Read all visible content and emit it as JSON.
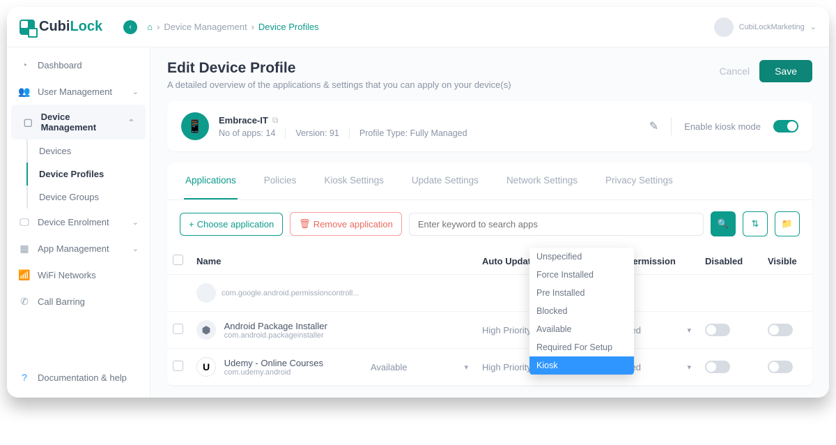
{
  "brand": {
    "name_a": "Cubi",
    "name_b": "Lock"
  },
  "breadcrumb": {
    "home": "⌂",
    "l1": "Device Management",
    "l2": "Device Profiles"
  },
  "user": {
    "name": "CubiLockMarketing"
  },
  "sidebar": {
    "items": [
      {
        "label": "Dashboard"
      },
      {
        "label": "User Management"
      },
      {
        "label": "Device Management"
      },
      {
        "label": "Device Enrolment"
      },
      {
        "label": "App Management"
      },
      {
        "label": "WiFi Networks"
      },
      {
        "label": "Call Barring"
      }
    ],
    "sub": [
      {
        "label": "Devices"
      },
      {
        "label": "Device Profiles"
      },
      {
        "label": "Device Groups"
      }
    ],
    "help": "Documentation & help"
  },
  "page": {
    "title": "Edit Device Profile",
    "subtitle": "A detailed overview of the applications & settings that you can apply on your device(s)",
    "cancel": "Cancel",
    "save": "Save"
  },
  "profile": {
    "name": "Embrace-IT",
    "apps_label": "No of apps: 14",
    "version_label": "Version: 91",
    "type_label": "Profile Type: Fully Managed",
    "kiosk_label": "Enable kiosk mode"
  },
  "tabs": [
    "Applications",
    "Policies",
    "Kiosk Settings",
    "Update Settings",
    "Network Settings",
    "Privacy Settings"
  ],
  "toolbar": {
    "choose": "Choose application",
    "remove": "Remove application",
    "search_ph": "Enter keyword to search apps"
  },
  "columns": {
    "name": "Name",
    "auto": "Auto Update Mode",
    "perm": "Default Permission",
    "disabled": "Disabled",
    "visible": "Visible"
  },
  "rows": [
    {
      "name": "",
      "pkg": "com.google.android.permissioncontroll...",
      "auto": "",
      "perm": ""
    },
    {
      "name": "Android Package Installer",
      "pkg": "com.android.packageinstaller",
      "auto": "High Priority",
      "perm": "Unspecified"
    },
    {
      "name": "Udemy - Online Courses",
      "pkg": "com.udemy.android",
      "install": "Available",
      "auto": "High Priority",
      "perm": "Unspecified"
    }
  ],
  "dropdown": [
    "Unspecified",
    "Force Installed",
    "Pre Installed",
    "Blocked",
    "Available",
    "Required For Setup",
    "Kiosk"
  ]
}
